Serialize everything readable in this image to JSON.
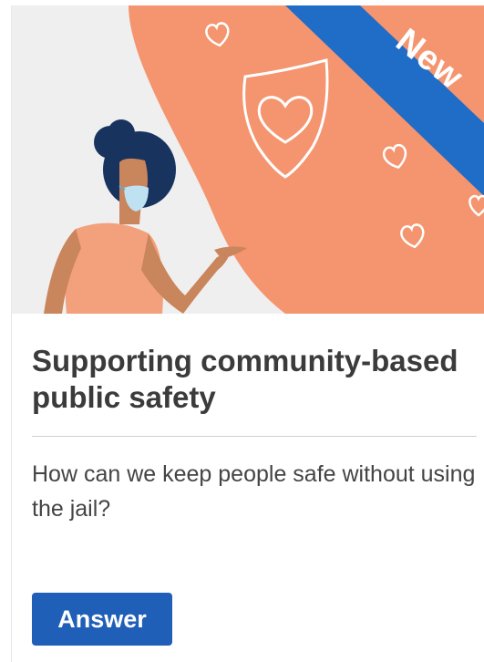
{
  "card": {
    "badge_label": "New",
    "title": "Supporting community-based public safety",
    "question": "How can we keep people safe without using the jail?",
    "answer_label": "Answer"
  },
  "colors": {
    "blob": "#f4956f",
    "ribbon": "#1f6dc7",
    "button": "#1f5fb8",
    "hair": "#18345e",
    "skin": "#c9855c",
    "mask": "#bfe2f2"
  },
  "illustration_icons": [
    "shield-heart-icon",
    "heart-icon",
    "person-with-mask"
  ]
}
